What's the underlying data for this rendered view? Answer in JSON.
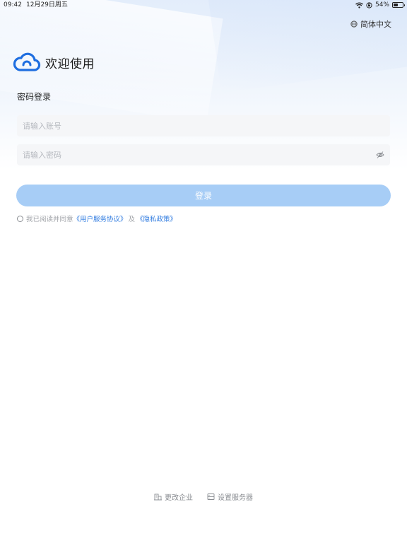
{
  "status_bar": {
    "time": "09:42",
    "date": "12月29日周五",
    "battery_percent": "54%",
    "battery_level": 0.54
  },
  "language": {
    "label": "简体中文",
    "icon": "globe-icon"
  },
  "brand": {
    "title": "欢迎使用",
    "logo": "cloud-logo-icon",
    "logo_color": "#1e6ee0"
  },
  "login": {
    "mode_label": "密码登录",
    "account_placeholder": "请输入账号",
    "account_value": "",
    "password_placeholder": "请输入密码",
    "password_value": "",
    "password_toggle_icon": "eye-off-icon",
    "submit_label": "登录",
    "submit_color": "#a7cdf6"
  },
  "agreement": {
    "prefix": "我已阅读并同意",
    "user_agreement": "《用户服务协议》",
    "conjunction": "及",
    "privacy_policy": "《隐私政策》",
    "checked": false,
    "link_color": "#2f7be0"
  },
  "footer": {
    "change_company_label": "更改企业",
    "change_company_icon": "building-icon",
    "server_settings_label": "设置服务器",
    "server_settings_icon": "server-icon"
  }
}
